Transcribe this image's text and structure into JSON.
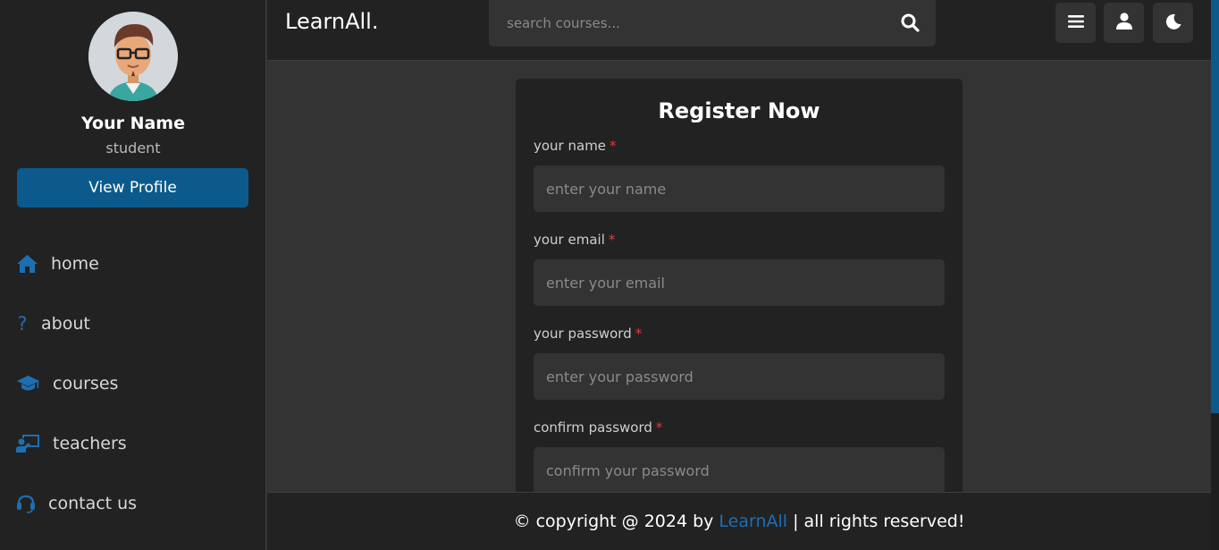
{
  "sidebar": {
    "profile": {
      "name": "Your Name",
      "role": "student",
      "view_button": "View Profile"
    },
    "items": [
      {
        "label": "home",
        "icon": "home-icon"
      },
      {
        "label": "about",
        "icon": "question-icon"
      },
      {
        "label": "courses",
        "icon": "graduation-cap-icon"
      },
      {
        "label": "teachers",
        "icon": "chalkboard-teacher-icon"
      },
      {
        "label": "contact us",
        "icon": "headset-icon"
      }
    ]
  },
  "header": {
    "logo": "LearnAll.",
    "search": {
      "placeholder": "search courses..."
    },
    "buttons": [
      "menu-icon",
      "user-icon",
      "moon-icon"
    ]
  },
  "form": {
    "title": "Register Now",
    "fields": [
      {
        "label": "your name",
        "required": "*",
        "placeholder": "enter your name"
      },
      {
        "label": "your email",
        "required": "*",
        "placeholder": "enter your email"
      },
      {
        "label": "your password",
        "required": "*",
        "placeholder": "enter your password"
      },
      {
        "label": "confirm password",
        "required": "*",
        "placeholder": "confirm your password"
      }
    ]
  },
  "footer": {
    "prefix": "© copyright @ 2024 by",
    "brand": "LearnAll",
    "suffix": "| all rights reserved!"
  },
  "colors": {
    "accent": "#0c5a8c",
    "icon_accent": "#1d6fb3",
    "required": "#e53935",
    "panel": "#222222",
    "background": "#333333"
  }
}
